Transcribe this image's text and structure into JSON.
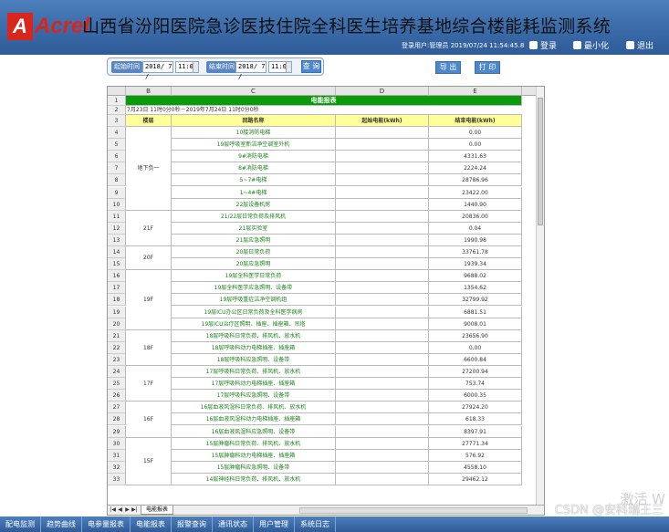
{
  "header": {
    "logo_mark": "A",
    "logo_text": "Acrel",
    "title": "山西省汾阳医院急诊医技住院全科医生培养基地综合楼能耗监测系统",
    "login_info": "登录用户:管理员 2019/07/24 11:54:45.8",
    "buttons": {
      "login": "登录",
      "minimize": "最小化",
      "exit": "退出"
    }
  },
  "toolbar": {
    "start_label": "起始时间",
    "start_date": "2018/ 7 /",
    "start_time": "11:00",
    "end_label": "结束时间",
    "end_date": "2018/ 7 /",
    "end_time": "11:00",
    "query": "查 询",
    "export": "导 出",
    "print": "打 印"
  },
  "sheet": {
    "col_letters": [
      "B",
      "C",
      "D",
      "E"
    ],
    "title": "电能报表",
    "period": "7月23日 11时0分0秒－2019年7月24日 11时0分0秒",
    "headers": [
      "楼层",
      "回路名称",
      "起始电能(kWh)",
      "结束电能(kWh)"
    ],
    "row_numbers": [
      "1",
      "2",
      "3",
      "4",
      "5",
      "6",
      "7",
      "8",
      "9",
      "10",
      "11",
      "12",
      "13",
      "14",
      "15",
      "16",
      "17",
      "18",
      "19",
      "20",
      "21",
      "22",
      "23",
      "24",
      "25",
      "26",
      "27",
      "28",
      "29",
      "30",
      "31",
      "32",
      "33"
    ],
    "groups": [
      {
        "floor": "地下负一",
        "rows": [
          {
            "name": "10楼消防电梯",
            "end": "0.00"
          },
          {
            "name": "19层呼吸室新洁净空调室外机",
            "end": "0.00"
          },
          {
            "name": "9#消防电梯",
            "end": "4331.63"
          },
          {
            "name": "8#消防电梯",
            "end": "2224.24"
          },
          {
            "name": "5~7#电梯",
            "end": "28786.96"
          },
          {
            "name": "1~4#电梯",
            "end": "23422.00"
          },
          {
            "name": "22层设备机房",
            "end": "1440.90"
          }
        ]
      },
      {
        "floor": "21F",
        "rows": [
          {
            "name": "21/22层日常负荷及排风机",
            "end": "20836.00"
          },
          {
            "name": "21层实验室",
            "end": "0.04"
          },
          {
            "name": "21层应急照明",
            "end": "1990.98"
          }
        ]
      },
      {
        "floor": "20F",
        "rows": [
          {
            "name": "20层日常负荷",
            "end": "33761.78"
          },
          {
            "name": "20层应急照明",
            "end": "1939.34"
          }
        ]
      },
      {
        "floor": "19F",
        "rows": [
          {
            "name": "19层全科医学日常负荷",
            "end": "9688.02"
          },
          {
            "name": "19层全科医学应急照明、设备带",
            "end": "1354.62"
          },
          {
            "name": "19层呼吸重症洁净空调机组",
            "end": "32799.92"
          },
          {
            "name": "19层ICU办公区日常负荷及全科医学病房",
            "end": "6881.51"
          },
          {
            "name": "19层ICU治疗区照明、插座、插座箱、吊塔",
            "end": "9008.01"
          }
        ]
      },
      {
        "floor": "18F",
        "rows": [
          {
            "name": "18层呼吸科日常负荷、排风机、放水机",
            "end": "23656.90"
          },
          {
            "name": "18层呼吸科动力电梯插座、插座箱",
            "end": "0.00"
          },
          {
            "name": "18层呼吸科应急照明、设备带",
            "end": "6600.84"
          }
        ]
      },
      {
        "floor": "17F",
        "rows": [
          {
            "name": "17层呼吸科日常负荷、排风机、放水机",
            "end": "27200.94"
          },
          {
            "name": "17层呼吸科动力电梯插座、插座箱",
            "end": "753.74"
          },
          {
            "name": "17层呼吸科应急照明、设备带",
            "end": "6000.35"
          }
        ]
      },
      {
        "floor": "16F",
        "rows": [
          {
            "name": "16层血液风湿科日常负荷、排风机、放水机",
            "end": "27924.20"
          },
          {
            "name": "16层血液风湿科动力电梯插座、插座箱",
            "end": "618.33"
          },
          {
            "name": "16层血液风湿科应急照明、设备带",
            "end": "8397.91"
          }
        ]
      },
      {
        "floor": "15F",
        "rows": [
          {
            "name": "15层肿瘤科日常负荷、排风机、放水机",
            "end": "27771.34"
          },
          {
            "name": "15层肿瘤科动力电梯插座、插座箱",
            "end": "576.92"
          },
          {
            "name": "15层肿瘤科应急照明、设备带",
            "end": "4558.10"
          },
          {
            "name": "14层神经科日常负荷、排风机、放水机",
            "end": "29462.12"
          }
        ]
      }
    ],
    "tab_name": "电能报表",
    "nav_arrows": [
      "|◀",
      "◀",
      "▶",
      "▶|"
    ]
  },
  "bottom_nav": [
    "配电监测",
    "趋势曲线",
    "电参量报表",
    "电能报表",
    "报警查询",
    "通讯状态",
    "用户管理",
    "系统日志"
  ],
  "overlay": {
    "watermark": "CSDN @安科瑞王三",
    "activate": "激活 W"
  }
}
